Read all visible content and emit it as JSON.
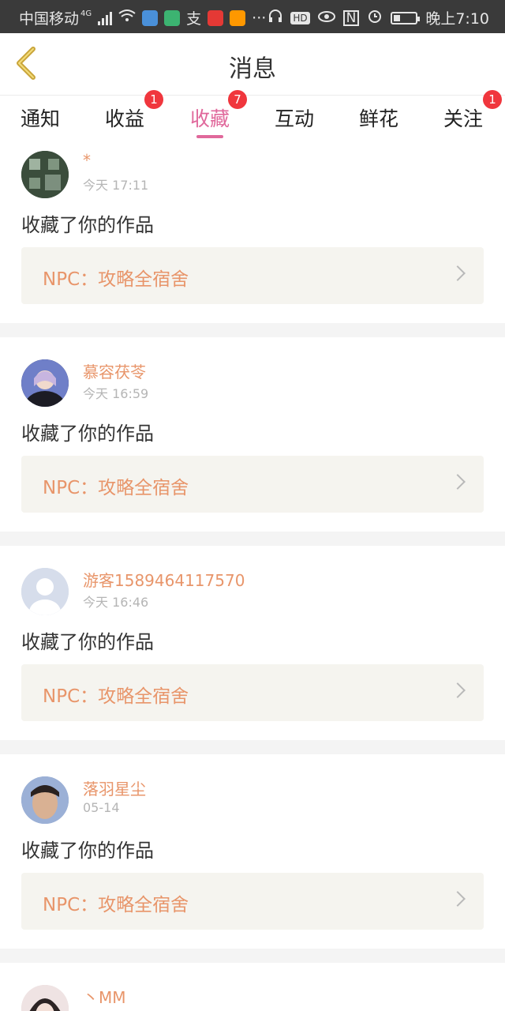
{
  "status_bar": {
    "carrier": "中国移动",
    "network": "4G",
    "hd_label": "HD",
    "time": "晚上7:10"
  },
  "header": {
    "title": "消息"
  },
  "tabs": [
    {
      "label": "通知",
      "badge": ""
    },
    {
      "label": "收益",
      "badge": "1"
    },
    {
      "label": "收藏",
      "badge": "7",
      "active": true
    },
    {
      "label": "互动",
      "badge": ""
    },
    {
      "label": "鲜花",
      "badge": ""
    },
    {
      "label": "关注",
      "badge": "1"
    }
  ],
  "messages": [
    {
      "username": "*",
      "time": "今天 17:11",
      "action": "收藏了你的作品",
      "work": "NPC：攻略全宿舍"
    },
    {
      "username": "慕容茯苓",
      "time": "今天 16:59",
      "action": "收藏了你的作品",
      "work": "NPC：攻略全宿舍"
    },
    {
      "username": "游客1589464117570",
      "time": "今天 16:46",
      "action": "收藏了你的作品",
      "work": "NPC：攻略全宿舍"
    },
    {
      "username": "落羽星尘",
      "time": "05-14",
      "action": "收藏了你的作品",
      "work": "NPC：攻略全宿舍"
    },
    {
      "username": "丶MM",
      "time": "",
      "action": "",
      "work": ""
    }
  ],
  "colors": {
    "accent_pink": "#e0689b",
    "username_orange": "#e8956a",
    "badge_red": "#f0363d",
    "card_bg": "#f5f4ef",
    "back_arrow": "#c9a53a"
  }
}
